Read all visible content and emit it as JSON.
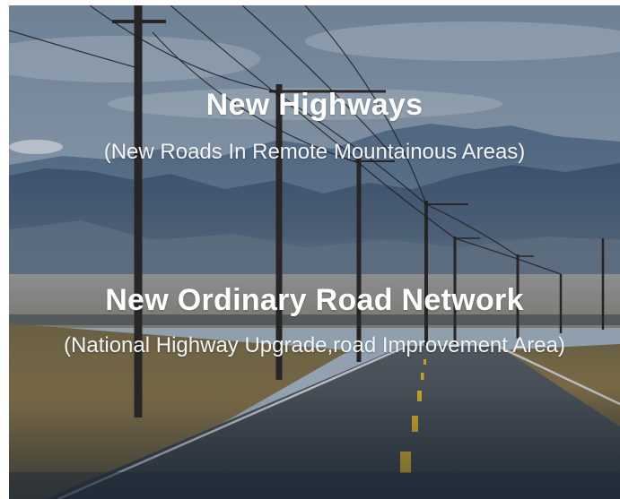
{
  "section_1": {
    "title": "New Highways",
    "subtitle": "(New Roads In Remote Mountainous Areas)"
  },
  "section_2": {
    "title": "New Ordinary Road Network",
    "subtitle": "(National Highway Upgrade,road Improvement Area)"
  },
  "colors": {
    "text": "#ffffff",
    "sky": "#8fa4b8",
    "mountains": "#4d6680",
    "road": "#3e444b",
    "center_line": "#e8b923",
    "grass": "#8a7440"
  }
}
